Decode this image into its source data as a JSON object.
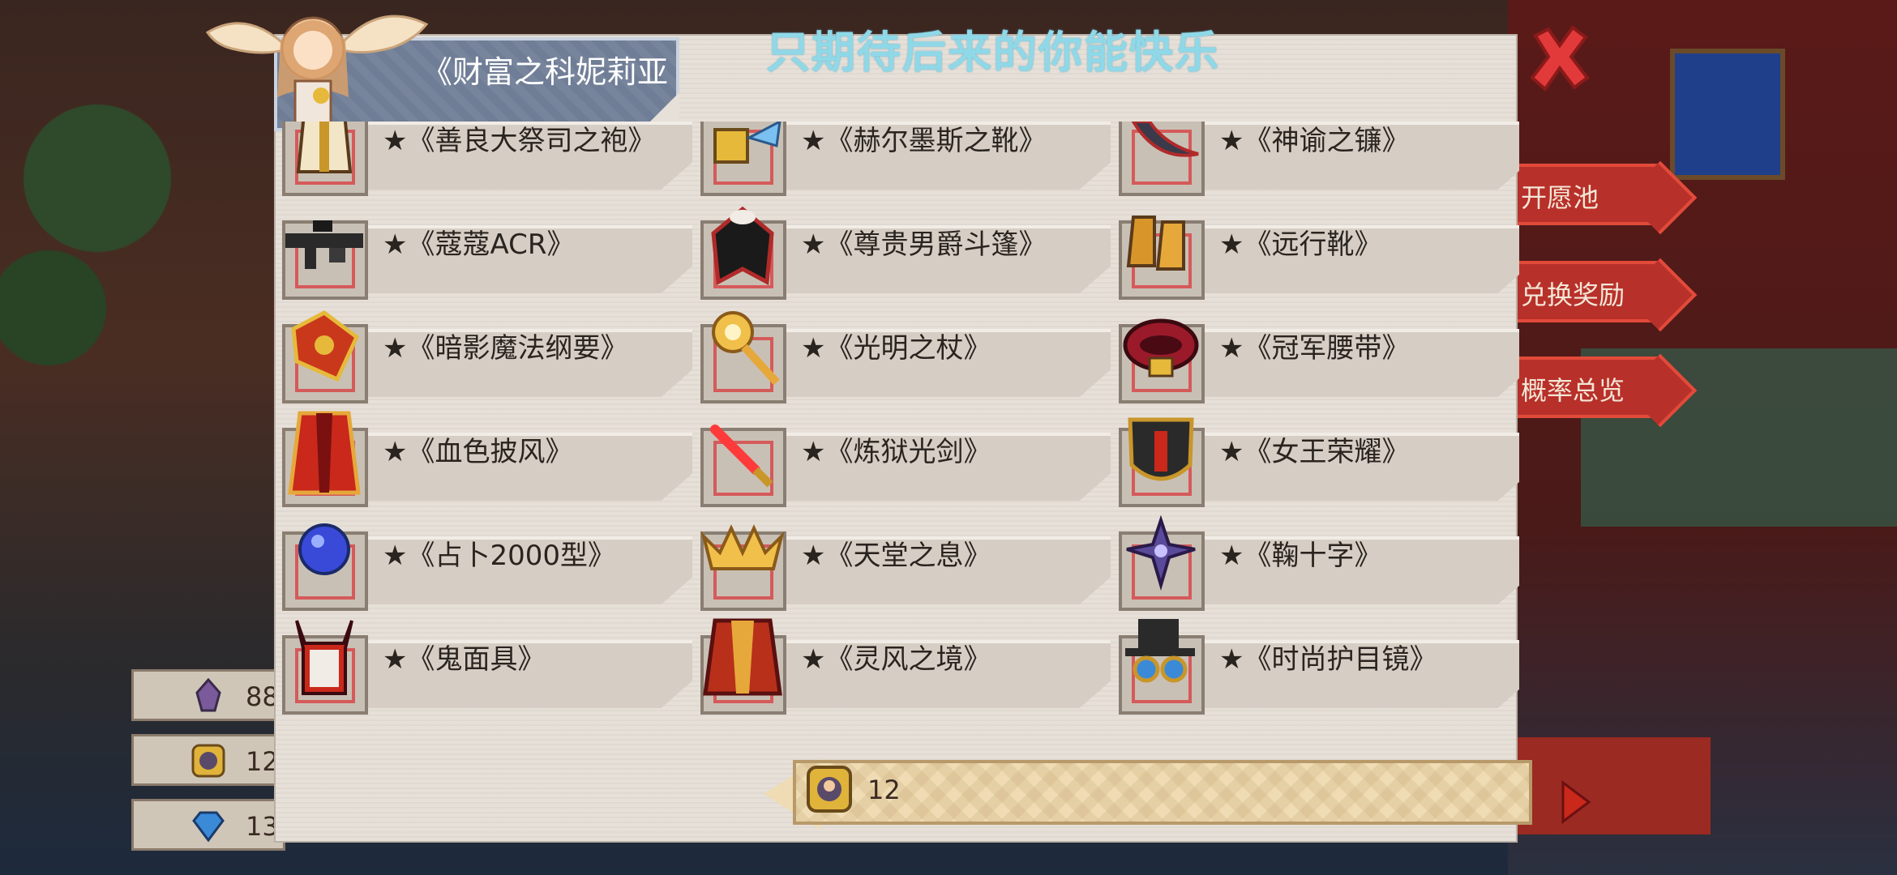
{
  "header": {
    "title": "只期待后来的你能快乐",
    "character_name": "《财富之科妮莉亚"
  },
  "side_buttons": [
    "开愿池",
    "兑换奖励",
    "概率总览"
  ],
  "resources": [
    {
      "icon": "crystal-icon",
      "value": "88"
    },
    {
      "icon": "coin-icon",
      "value": "12"
    },
    {
      "icon": "diamond-icon",
      "value": "13"
    }
  ],
  "items": [
    {
      "label": "★《善良大祭司之袍》",
      "icon": "robe-icon"
    },
    {
      "label": "★《赫尔墨斯之靴》",
      "icon": "winged-boots-icon"
    },
    {
      "label": "★《神谕之镰》",
      "icon": "scythe-icon"
    },
    {
      "label": "★《蔻蔻ACR》",
      "icon": "rifle-icon"
    },
    {
      "label": "★《尊贵男爵斗篷》",
      "icon": "cloak-icon"
    },
    {
      "label": "★《远行靴》",
      "icon": "boots-icon"
    },
    {
      "label": "★《暗影魔法纲要》",
      "icon": "spellbook-icon"
    },
    {
      "label": "★《光明之杖》",
      "icon": "light-staff-icon"
    },
    {
      "label": "★《冠军腰带》",
      "icon": "belt-icon"
    },
    {
      "label": "★《血色披风》",
      "icon": "crimson-cape-icon"
    },
    {
      "label": "★《炼狱光剑》",
      "icon": "lightsaber-icon"
    },
    {
      "label": "★《女王荣耀》",
      "icon": "shield-icon"
    },
    {
      "label": "★《占卜2000型》",
      "icon": "crystal-ball-icon"
    },
    {
      "label": "★《天堂之息》",
      "icon": "halo-crown-icon"
    },
    {
      "label": "★《鞠十字》",
      "icon": "cross-icon"
    },
    {
      "label": "★《鬼面具》",
      "icon": "demon-mask-icon"
    },
    {
      "label": "★《灵风之境》",
      "icon": "spirit-cloak-icon"
    },
    {
      "label": "★《时尚护目镜》",
      "icon": "goggles-hat-icon"
    }
  ],
  "cost": {
    "icon": "coin-icon",
    "value": "12"
  },
  "colors": {
    "title": "#8fd8e8",
    "panel": "#e7e0d8",
    "frame_accent": "#d55a5a",
    "close": "#e23a3a"
  }
}
